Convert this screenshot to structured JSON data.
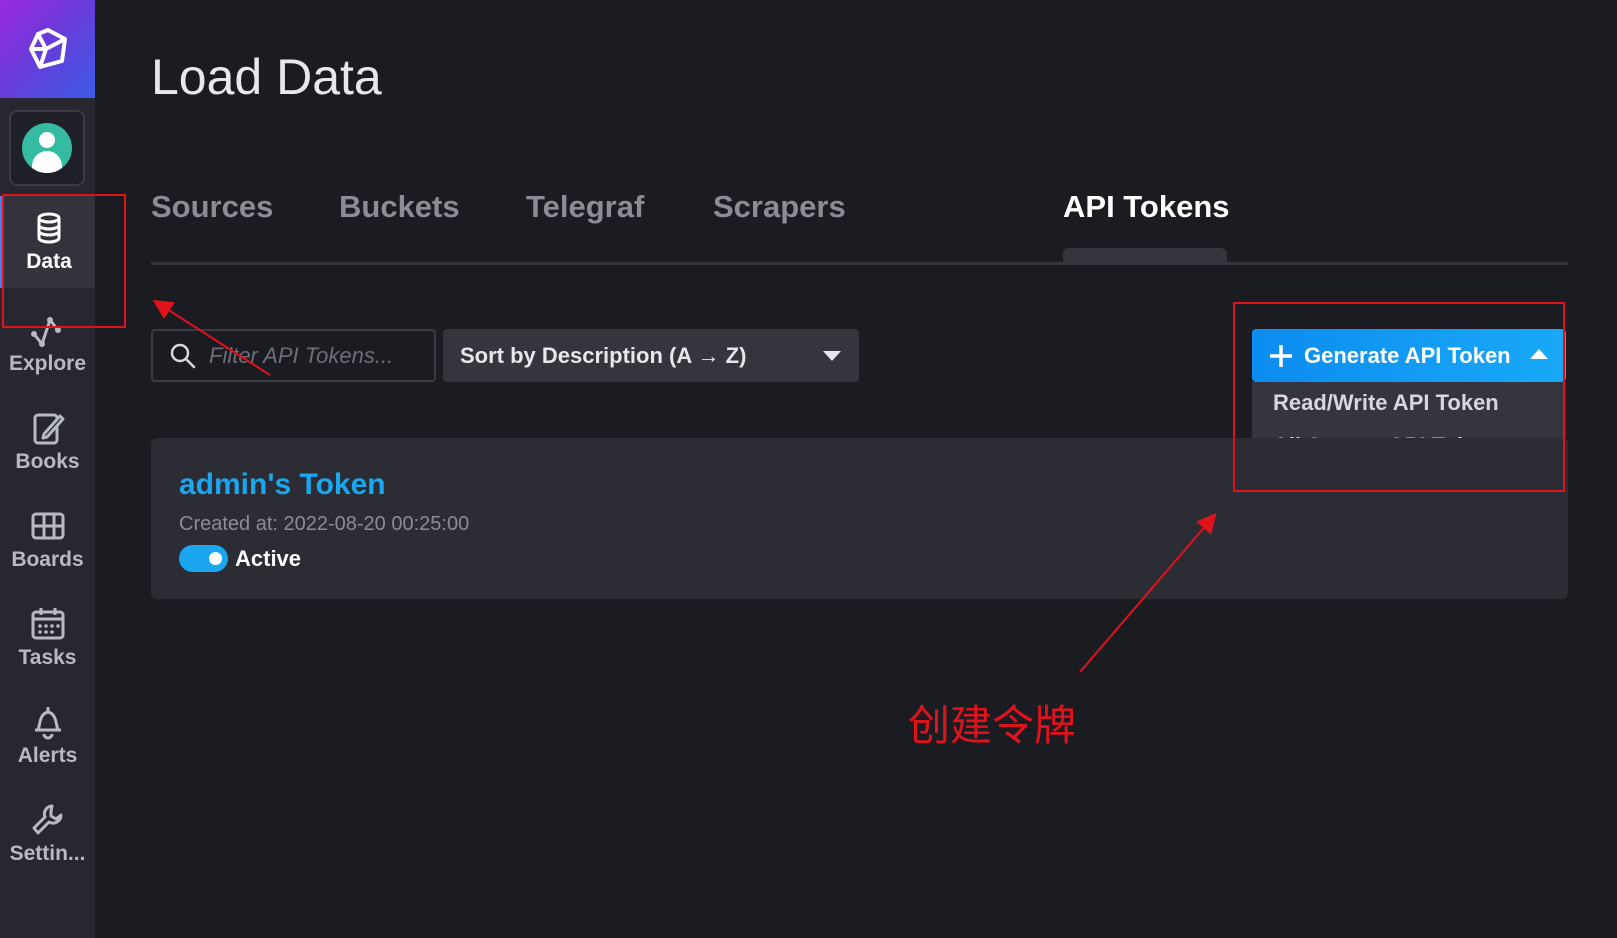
{
  "sidebar": {
    "items": [
      {
        "label": "Data",
        "icon": "database-icon"
      },
      {
        "label": "Explore",
        "icon": "graph-icon"
      },
      {
        "label": "Books",
        "icon": "notebook-icon"
      },
      {
        "label": "Boards",
        "icon": "dashboard-icon"
      },
      {
        "label": "Tasks",
        "icon": "calendar-icon"
      },
      {
        "label": "Alerts",
        "icon": "bell-icon"
      },
      {
        "label": "Settin...",
        "icon": "wrench-icon"
      }
    ]
  },
  "page": {
    "title": "Load Data"
  },
  "tabs": [
    {
      "label": "Sources"
    },
    {
      "label": "Buckets"
    },
    {
      "label": "Telegraf"
    },
    {
      "label": "Scrapers"
    },
    {
      "label": "API Tokens"
    }
  ],
  "toolbar": {
    "filter_placeholder": "Filter API Tokens...",
    "sort_label": "Sort by Description (A → Z)",
    "generate_label": "Generate API Token",
    "menu": [
      "Read/Write API Token",
      "All Access API Token"
    ]
  },
  "token": {
    "name": "admin's Token",
    "created": "Created at: 2022-08-20 00:25:00",
    "status": "Active"
  },
  "annotation": {
    "text": "创建令牌"
  },
  "colors": {
    "accent": "#1aa7f0",
    "annotation": "#e0121b",
    "background": "#1b1c22"
  }
}
